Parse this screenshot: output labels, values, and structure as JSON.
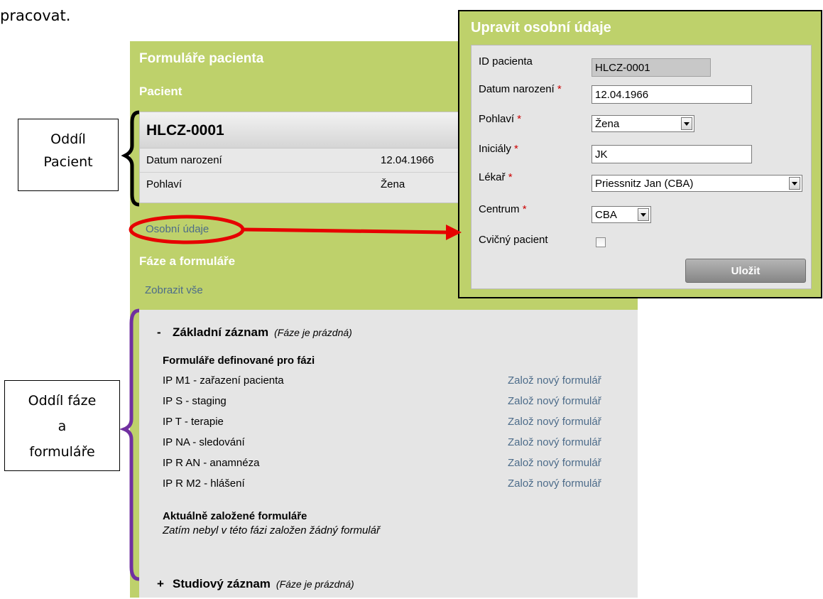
{
  "intro_text": "pracovat.",
  "panel": {
    "title": "Formuláře pacienta",
    "patient_heading": "Pacient",
    "patient": {
      "id": "HLCZ-0001",
      "rows": [
        {
          "label": "Datum narození",
          "value": "12.04.1966"
        },
        {
          "label": "Pohlaví",
          "value": "Žena"
        }
      ]
    },
    "personal_link": "Osobní údaje",
    "phases_heading": "Fáze a formuláře",
    "show_all_link": "Zobrazit vše",
    "phases": [
      {
        "sign": "-",
        "name": "Základní záznam",
        "status": "(Fáze je prázdná)",
        "defined_title": "Formuláře definované pro fázi",
        "forms": [
          {
            "name": "IP M1 - zařazení pacienta",
            "action": "Založ nový formulář"
          },
          {
            "name": "IP S - staging",
            "action": "Založ nový formulář"
          },
          {
            "name": "IP T - terapie",
            "action": "Založ nový formulář"
          },
          {
            "name": "IP NA - sledování",
            "action": "Založ nový formulář"
          },
          {
            "name": "IP R AN - anamnéza",
            "action": "Založ nový formulář"
          },
          {
            "name": "IP R M2 - hlášení",
            "action": "Založ nový formulář"
          }
        ],
        "current_title": "Aktuálně založené formuláře",
        "current_empty": "Zatím nebyl v této fázi založen žádný formulář"
      },
      {
        "sign": "+",
        "name": "Studiový záznam",
        "status": "(Fáze je prázdná)"
      }
    ]
  },
  "popup": {
    "title": "Upravit osobní údaje",
    "fields": {
      "patient_id": {
        "label": "ID pacienta",
        "value": "HLCZ-0001"
      },
      "birth_date": {
        "label": "Datum narození",
        "value": "12.04.1966"
      },
      "sex": {
        "label": "Pohlaví",
        "value": "Žena"
      },
      "initials": {
        "label": "Iniciály",
        "value": "JK"
      },
      "doctor": {
        "label": "Lékař",
        "value": "Priessnitz Jan (CBA)"
      },
      "center": {
        "label": "Centrum",
        "value": "CBA"
      },
      "test_patient": {
        "label": "Cvičný pacient",
        "checked": false
      }
    },
    "required_mark": "*",
    "save_label": "Uložit"
  },
  "annotations": {
    "patient_section": [
      "Oddíl",
      "Pacient"
    ],
    "phase_section": [
      "Oddíl fáze",
      "a",
      "formuláře"
    ]
  },
  "colors": {
    "panel_green": "#bed16b",
    "link": "#4d6c8a",
    "arrow_red": "#e60000",
    "bracket_purple": "#7030a0",
    "required_red": "#cc0000"
  }
}
